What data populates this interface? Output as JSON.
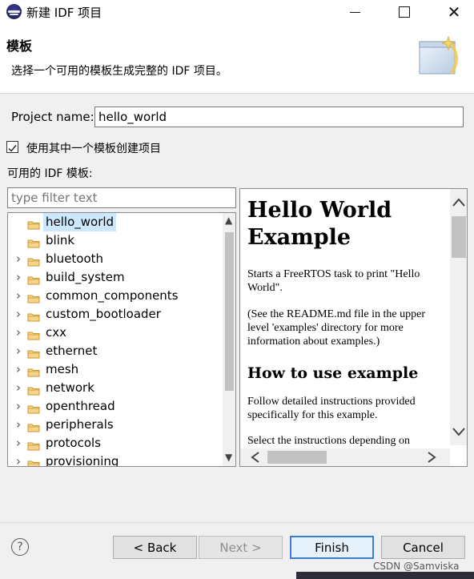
{
  "window": {
    "title": "新建 IDF 项目",
    "controls": {
      "minimize_icon": "minimize-icon",
      "maximize_icon": "maximize-icon",
      "close_glyph": "✕"
    }
  },
  "banner": {
    "title": "模板",
    "description": "选择一个可用的模板生成完整的 IDF 项目。"
  },
  "form": {
    "project_name_label": "Project name:",
    "project_name_value": "hello_world",
    "use_template_label": "使用其中一个模板创建项目",
    "use_template_checked": true,
    "available_templates_label": "可用的 IDF 模板:",
    "filter_placeholder": "type filter text"
  },
  "template_tree": {
    "items": [
      {
        "label": "hello_world",
        "expandable": false,
        "selected": true
      },
      {
        "label": "blink",
        "expandable": false,
        "selected": false
      },
      {
        "label": "bluetooth",
        "expandable": true,
        "selected": false
      },
      {
        "label": "build_system",
        "expandable": true,
        "selected": false
      },
      {
        "label": "common_components",
        "expandable": true,
        "selected": false
      },
      {
        "label": "custom_bootloader",
        "expandable": true,
        "selected": false
      },
      {
        "label": "cxx",
        "expandable": true,
        "selected": false
      },
      {
        "label": "ethernet",
        "expandable": true,
        "selected": false
      },
      {
        "label": "mesh",
        "expandable": true,
        "selected": false
      },
      {
        "label": "network",
        "expandable": true,
        "selected": false
      },
      {
        "label": "openthread",
        "expandable": true,
        "selected": false
      },
      {
        "label": "peripherals",
        "expandable": true,
        "selected": false
      },
      {
        "label": "protocols",
        "expandable": true,
        "selected": false
      },
      {
        "label": "provisioning",
        "expandable": true,
        "selected": false
      }
    ]
  },
  "preview": {
    "heading_line1": "Hello World",
    "heading_line2": "Example",
    "para1": "Starts a FreeRTOS task to print \"Hello World\".",
    "para2": "(See the README.md file in the upper level 'examples' directory for more information about examples.)",
    "subheading": "How to use example",
    "para3": "Follow detailed instructions provided specifically for this example.",
    "para4": "Select the instructions depending on"
  },
  "buttons": {
    "help_glyph": "?",
    "back": "< Back",
    "next": "Next >",
    "finish": "Finish",
    "cancel": "Cancel"
  },
  "watermark": "CSDN @Samviska"
}
